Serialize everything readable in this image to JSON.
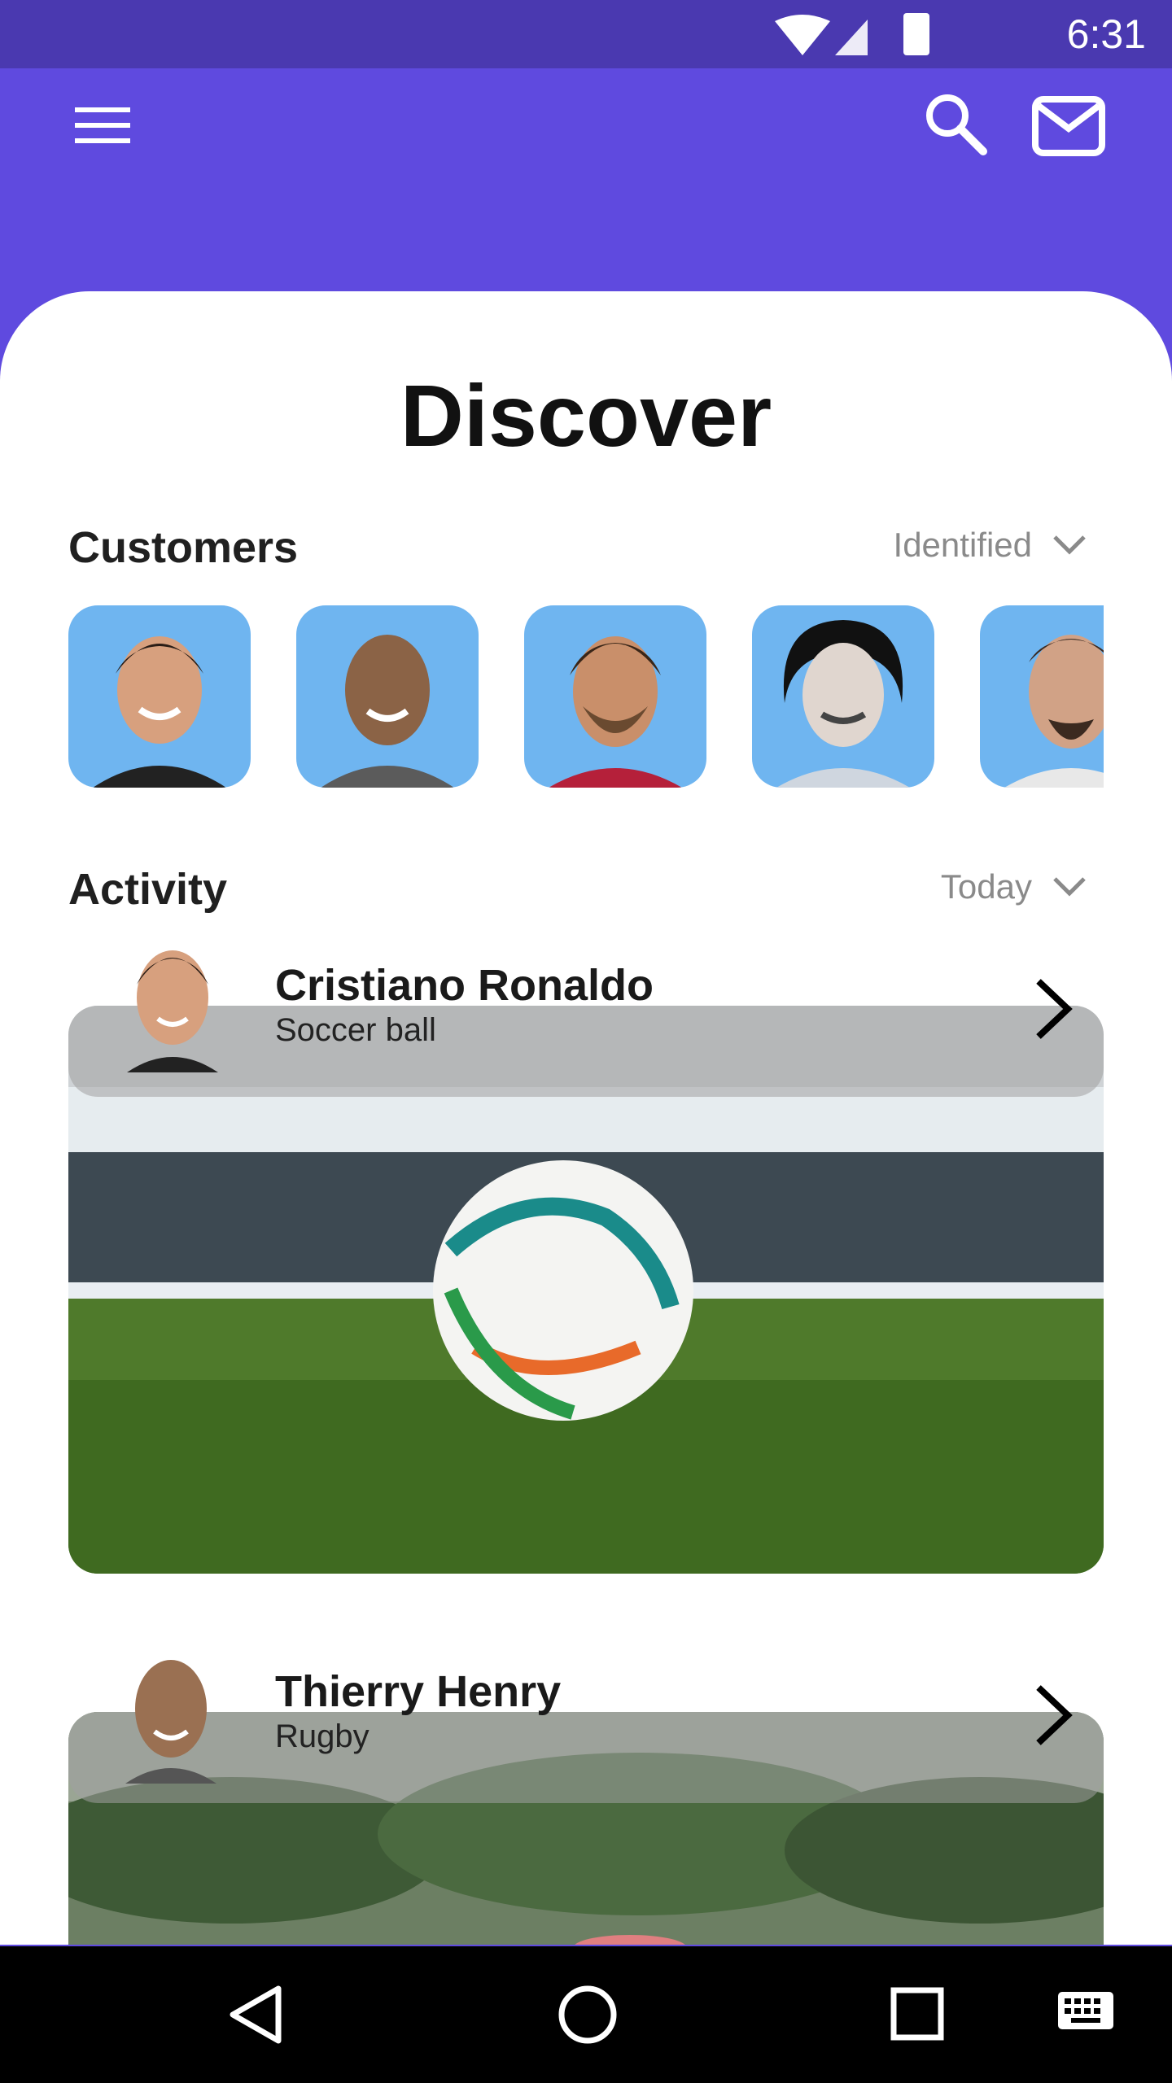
{
  "status_bar": {
    "time": "6:31"
  },
  "app_bar": {
    "menu_icon": "menu-icon",
    "search_icon": "search-icon",
    "mail_icon": "mail-icon"
  },
  "page": {
    "title": "Discover"
  },
  "customers": {
    "title": "Customers",
    "filter": "Identified",
    "avatars": [
      "avatar-1",
      "avatar-2",
      "avatar-3",
      "avatar-4",
      "avatar-5"
    ]
  },
  "activity": {
    "title": "Activity",
    "filter": "Today",
    "items": [
      {
        "name": "Cristiano Ronaldo",
        "subtitle": "Soccer ball"
      },
      {
        "name": "Thierry Henry",
        "subtitle": "Rugby"
      }
    ]
  },
  "colors": {
    "primary": "#5f4adf",
    "status": "#4a39b0",
    "avatar_bg": "#6fb5f0"
  }
}
